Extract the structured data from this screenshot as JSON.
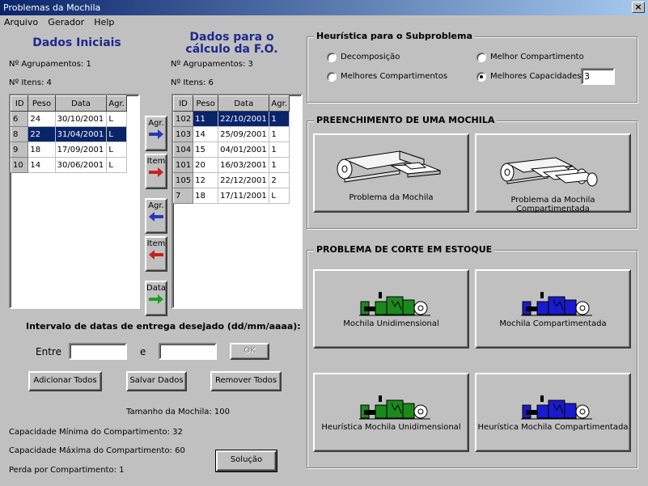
{
  "window": {
    "title": "Problemas da Mochila",
    "close": "×"
  },
  "menu": [
    {
      "label": "Arquivo"
    },
    {
      "label": "Gerador"
    },
    {
      "label": "Help"
    }
  ],
  "left": {
    "title": "Dados Iniciais",
    "groups_label": "Nº Agrupamentos:  1",
    "items_label": "Nº Itens:  4",
    "columns": [
      "ID",
      "Peso",
      "Data",
      "Agr."
    ],
    "rows": [
      {
        "id": "6",
        "peso": "24",
        "data": "30/10/2001",
        "agr": "L",
        "selected": false
      },
      {
        "id": "8",
        "peso": "22",
        "data": "31/04/2001",
        "agr": "L",
        "selected": true
      },
      {
        "id": "9",
        "peso": "18",
        "data": "17/09/2001",
        "agr": "L",
        "selected": false
      },
      {
        "id": "10",
        "peso": "14",
        "data": "30/06/2001",
        "agr": "L",
        "selected": false
      }
    ]
  },
  "right": {
    "title_line1": "Dados para o",
    "title_line2": "cálculo da F.O.",
    "groups_label": "Nº Agrupamentos:  3",
    "items_label": "Nº Itens:  6",
    "columns": [
      "ID",
      "Peso",
      "Data",
      "Agr."
    ],
    "rows": [
      {
        "id": "102",
        "peso": "11",
        "data": "22/10/2001",
        "agr": "1",
        "selected": true
      },
      {
        "id": "103",
        "peso": "14",
        "data": "25/09/2001",
        "agr": "1",
        "selected": false
      },
      {
        "id": "104",
        "peso": "15",
        "data": "04/01/2001",
        "agr": "1",
        "selected": false
      },
      {
        "id": "101",
        "peso": "20",
        "data": "16/03/2001",
        "agr": "1",
        "selected": false
      },
      {
        "id": "105",
        "peso": "12",
        "data": "22/12/2001",
        "agr": "2",
        "selected": false
      },
      {
        "id": "7",
        "peso": "18",
        "data": "17/11/2001",
        "agr": "L",
        "selected": false
      }
    ]
  },
  "move_buttons": [
    {
      "label": "Agr.",
      "arrow": "right-arrow-blue",
      "color": "#2838b8"
    },
    {
      "label": "Item",
      "arrow": "right-arrow-red",
      "color": "#c82020"
    },
    {
      "label": "Agr.",
      "arrow": "left-arrow-blue",
      "color": "#2838b8"
    },
    {
      "label": "Item",
      "arrow": "left-arrow-red",
      "color": "#c82020"
    },
    {
      "label": "Data",
      "arrow": "right-arrow-green",
      "color": "#20a020"
    }
  ],
  "interval": {
    "title": "Intervalo de datas de entrega desejado (dd/mm/aaaa):",
    "between": "Entre",
    "and": "e",
    "from_value": "",
    "to_value": "",
    "ok": "OK"
  },
  "actions": {
    "add_all": "Adicionar Todos",
    "save": "Salvar Dados",
    "remove_all": "Remover Todos"
  },
  "summary": {
    "size": "Tamanho da Mochila:   100",
    "min_cap": "Capacidade Mínima do Compartimento:  32",
    "max_cap": "Capacidade Máxima do Compartimento:  60",
    "loss": "Perda por Compartimento:  1",
    "solution": "Solução"
  },
  "heuristic": {
    "title": "Heurística para o Subproblema",
    "options": [
      {
        "label": "Decomposição",
        "checked": false
      },
      {
        "label": "Melhor Compartimento",
        "checked": false
      },
      {
        "label": "Melhores Compartimentos",
        "checked": false
      },
      {
        "label": "Melhores Capacidades",
        "checked": true
      }
    ],
    "capacity_value": "3"
  },
  "fill": {
    "title": "PREENCHIMENTO DE UMA MOCHILA",
    "btn1": "Problema da Mochila",
    "btn2": "Problema da Mochila Compartimentada"
  },
  "cut": {
    "title": "PROBLEMA DE CORTE EM ESTOQUE",
    "btn1": "Mochila Unidimensional",
    "btn2": "Mochila Compartimentada",
    "btn3": "Heurística Mochila Unidimensional",
    "btn4": "Heurística Mochila Compartimentada"
  },
  "colors": {
    "selection": "#0a246a",
    "heading": "#1c2a8c",
    "machine_green": "#1a8a1a",
    "machine_blue": "#1a1ad0"
  }
}
